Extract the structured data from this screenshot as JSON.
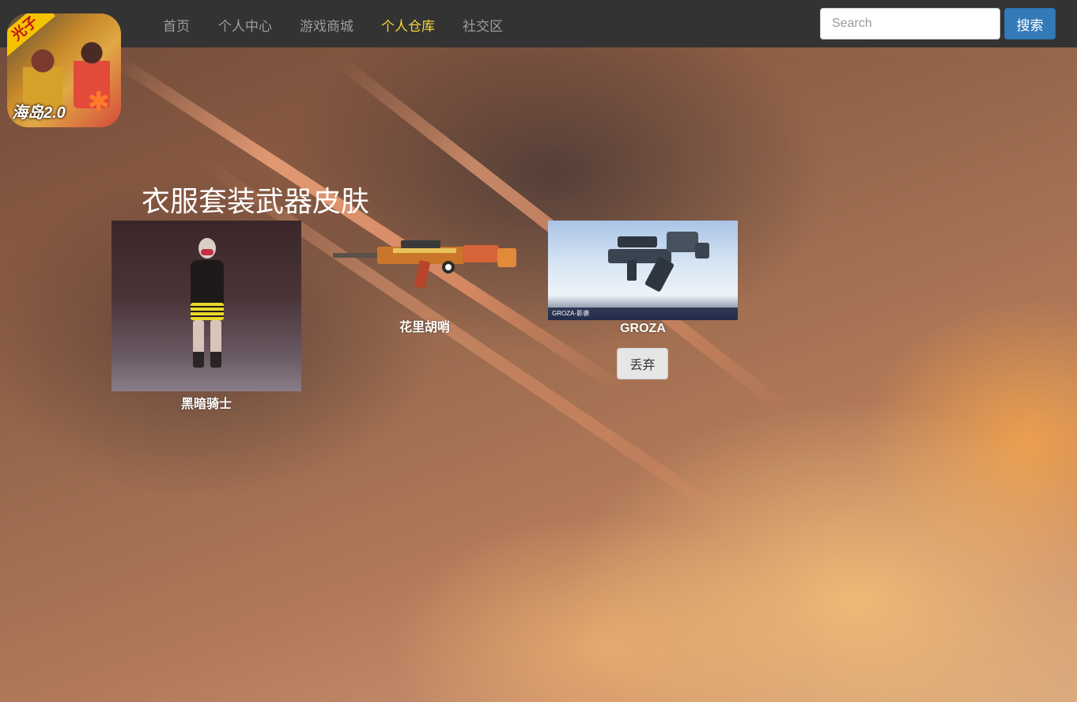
{
  "nav": {
    "items": [
      {
        "label": "首页"
      },
      {
        "label": "个人中心"
      },
      {
        "label": "游戏商城"
      },
      {
        "label": "个人仓库"
      },
      {
        "label": "社交区"
      }
    ],
    "active_index": 3,
    "active_color": "#f6d33c"
  },
  "search": {
    "placeholder": "Search",
    "value": "",
    "button_label": "搜索"
  },
  "logo": {
    "badge_text": "光子",
    "subtitle_text": "海岛2.0",
    "icon": "game-logo"
  },
  "warehouse": {
    "title": "衣服套装武器皮肤",
    "items": [
      {
        "name": "黑暗骑士",
        "image": "outfit-image"
      },
      {
        "name": "花里胡哨",
        "image": "rifle-skin-image"
      },
      {
        "name": "GROZA",
        "image": "groza-image",
        "image_caption": "GROZA-影袭",
        "action_label": "丢弃"
      }
    ]
  },
  "colors": {
    "navbar": "#333333",
    "nav_text": "#9d9d9d",
    "search_button": "#337ab7",
    "title_text": "#ffffff"
  }
}
